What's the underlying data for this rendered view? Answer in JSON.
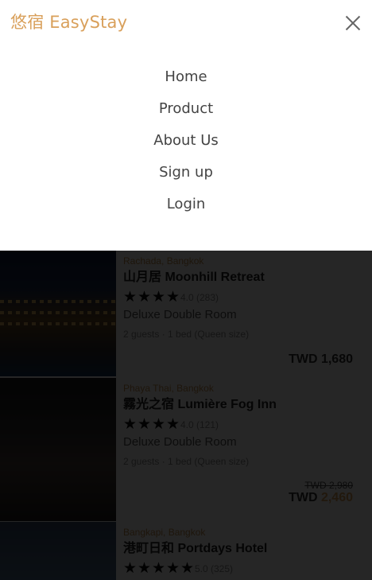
{
  "brand": {
    "name": "悠宿 EasyStay"
  },
  "nav": {
    "items": [
      {
        "label": "Home"
      },
      {
        "label": "Product"
      },
      {
        "label": "About Us"
      },
      {
        "label": "Sign up"
      },
      {
        "label": "Login"
      }
    ]
  },
  "hotels": [
    {
      "location": "Rachada, Bangkok",
      "name": "山月居 Moonhill Retreat",
      "stars": 4,
      "rating_text": "4.0 (283)",
      "room": "Deluxe Double Room",
      "specs": "2 guests · 1 bed (Queen size)",
      "currency": "TWD",
      "price": "1,680",
      "old_price": ""
    },
    {
      "location": "Phaya Thai, Bangkok",
      "name": "霧光之宿 Lumière Fog Inn",
      "stars": 4,
      "rating_text": "4.0 (121)",
      "room": "Deluxe Double Room",
      "specs": "2 guests · 1 bed (Queen size)",
      "currency": "TWD",
      "price": "2,460",
      "old_price": "TWD 2,980"
    },
    {
      "location": "Bangkapi, Bangkok",
      "name": "港町日和 Portdays Hotel",
      "stars": 5,
      "rating_text": "5.0 (325)"
    }
  ],
  "colors": {
    "accent": "#d9a05b",
    "overlay": "#000000"
  },
  "icons": {
    "close": "close-icon",
    "star": "star-icon"
  }
}
